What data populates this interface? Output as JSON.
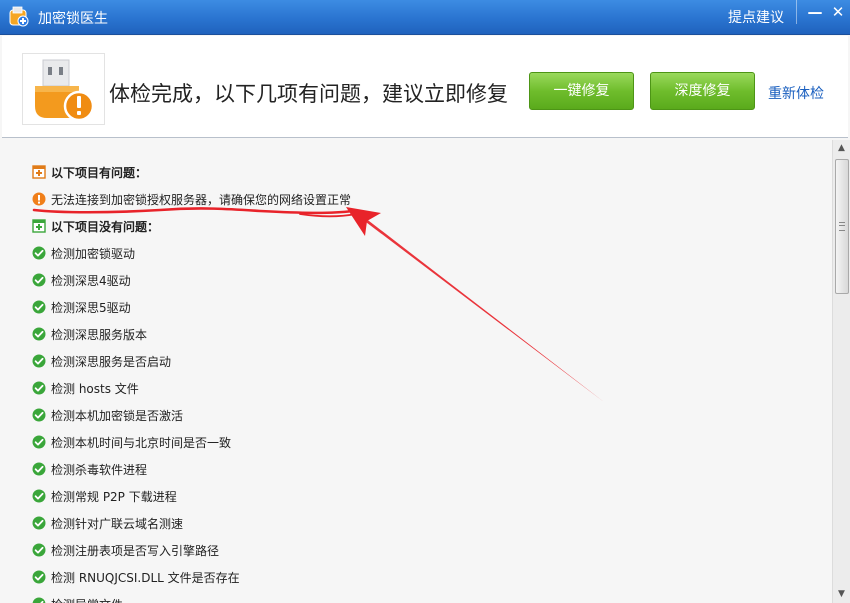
{
  "window": {
    "title": "加密锁医生",
    "feedback_label": "提点建议",
    "minimize_glyph": "—",
    "close_glyph": "✕"
  },
  "header": {
    "headline": "体检完成，以下几项有问题，建议立即修复",
    "one_click_fix_label": "一键修复",
    "deep_fix_label": "深度修复",
    "recheck_label": "重新体检"
  },
  "results": {
    "problem_section_label": "以下项目有问题：",
    "problems": [
      "无法连接到加密锁授权服务器，请确保您的网络设置正常"
    ],
    "ok_section_label": "以下项目没有问题：",
    "ok_items": [
      "检测加密锁驱动",
      "检测深思4驱动",
      "检测深思5驱动",
      "检测深思服务版本",
      "检测深思服务是否启动",
      "检测 hosts 文件",
      "检测本机加密锁是否激活",
      "检测本机时间与北京时间是否一致",
      "检测杀毒软件进程",
      "检测常规 P2P 下载进程",
      "检测针对广联云域名测速",
      "检测注册表项是否写入引擎路径",
      "检测 RNUQJCSI.DLL 文件是否存在",
      "检测异常文件"
    ]
  },
  "icons": {
    "app": "dongle-doctor-icon",
    "problem_section": "expand-square-icon",
    "ok_section": "expand-square-icon",
    "problem_item": "warning-circle-icon",
    "ok_item": "check-circle-icon"
  },
  "colors": {
    "titlebar": "#2a74d0",
    "button_green": "#6fbd2c",
    "link_blue": "#1a5fbf",
    "warning_orange": "#f07f1a",
    "check_green": "#3aa63a",
    "annotation_red": "#e8232a"
  }
}
